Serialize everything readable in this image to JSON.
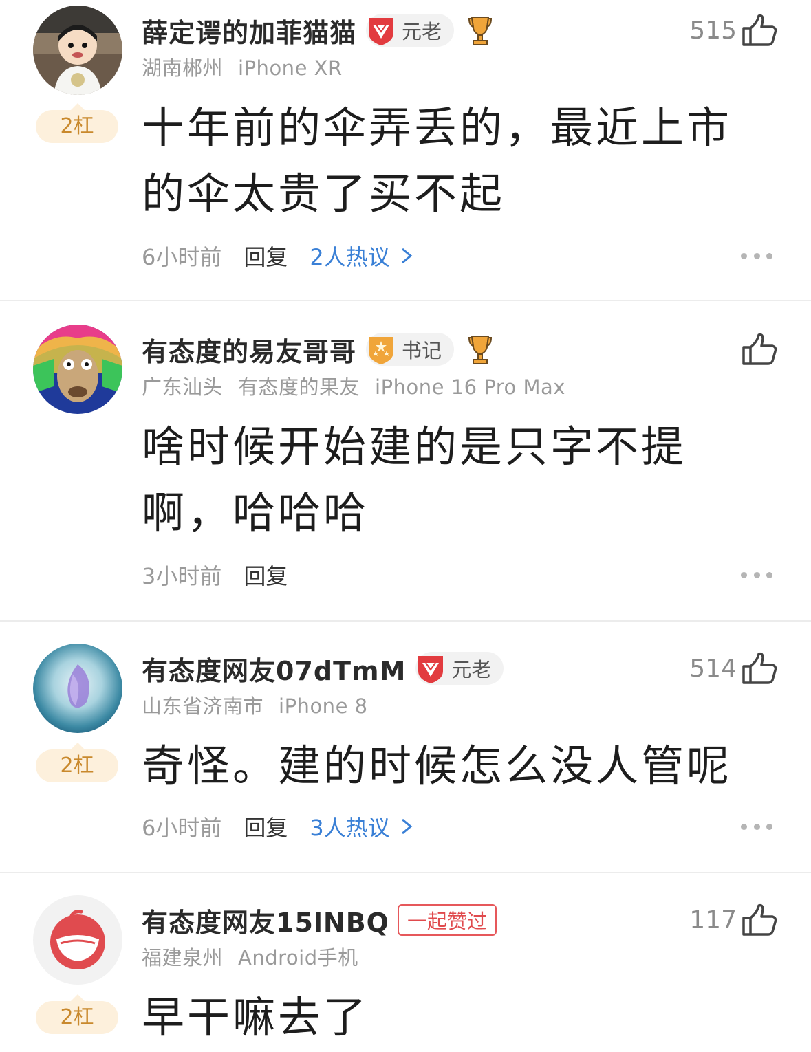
{
  "comments": [
    {
      "username": "薛定谔的加菲猫猫",
      "badge": "元老",
      "location": "湖南郴州",
      "device": "iPhone XR",
      "likes": "515",
      "floor": "2杠",
      "text": "十年前的伞弄丢的，最近上市的伞太贵了买不起",
      "time": "6小时前",
      "reply": "回复",
      "hot": "2人热议"
    },
    {
      "username": "有态度的易友哥哥",
      "badge": "书记",
      "location": "广东汕头",
      "tag": "有态度的果友",
      "device": "iPhone 16 Pro Max",
      "text": "啥时候开始建的是只字不提啊，哈哈哈",
      "time": "3小时前",
      "reply": "回复"
    },
    {
      "username": "有态度网友07dTmM",
      "badge": "元老",
      "location": "山东省济南市",
      "device": "iPhone 8",
      "likes": "514",
      "floor": "2杠",
      "text": "奇怪。建的时候怎么没人管呢",
      "time": "6小时前",
      "reply": "回复",
      "hot": "3人热议"
    },
    {
      "username": "有态度网友15lNBQ",
      "badge": "一起赞过",
      "location": "福建泉州",
      "device": "Android手机",
      "likes": "117",
      "floor": "2杠",
      "text": "早干嘛去了"
    }
  ],
  "colors": {
    "link_blue": "#3a80d6",
    "pill_bg": "#fdf0dc",
    "pill_text": "#c9892d",
    "badge_red": "#e23b3f",
    "badge_gold": "#f0a53a"
  },
  "icons": [
    "thumbs-up-icon",
    "ruby-shield-icon",
    "star-shield-icon",
    "trophy-icon",
    "chevron-right-icon",
    "more-dots-icon"
  ]
}
